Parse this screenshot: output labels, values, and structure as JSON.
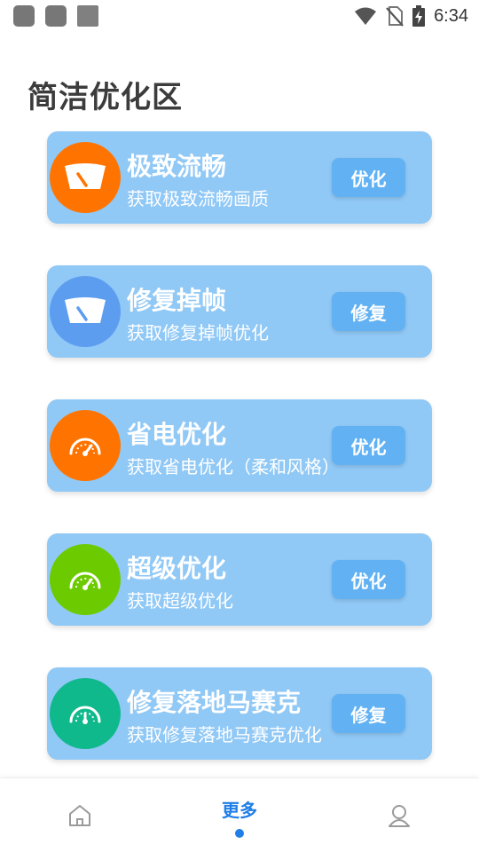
{
  "status_bar": {
    "time": "6:34",
    "icons": [
      "app-icon",
      "app-icon",
      "app-icon",
      "wifi-icon",
      "no-sim-icon",
      "battery-charging-icon"
    ]
  },
  "page": {
    "title": "简洁优化区"
  },
  "cards": [
    {
      "title": "极致流畅",
      "subtitle": "获取极致流畅画质",
      "action": "优化",
      "icon": "speedometer-icon",
      "color": "#ff7400"
    },
    {
      "title": "修复掉帧",
      "subtitle": "获取修复掉帧优化",
      "action": "修复",
      "icon": "speedometer-icon",
      "color": "#5c9df0"
    },
    {
      "title": "省电优化",
      "subtitle": "获取省电优化（柔和风格）",
      "action": "优化",
      "icon": "gauge-icon",
      "color": "#ff7400"
    },
    {
      "title": "超级优化",
      "subtitle": "获取超级优化",
      "action": "优化",
      "icon": "gauge-icon",
      "color": "#6ccb00"
    },
    {
      "title": "修复落地马赛克",
      "subtitle": "获取修复落地马赛克优化",
      "action": "修复",
      "icon": "gauge-icon",
      "color": "#10b98c"
    }
  ],
  "bottom_nav": {
    "items": [
      {
        "icon": "home-icon",
        "label": ""
      },
      {
        "icon": "",
        "label": "更多",
        "active": true
      },
      {
        "icon": "profile-icon",
        "label": ""
      }
    ],
    "accent": "#1f7ee8"
  }
}
